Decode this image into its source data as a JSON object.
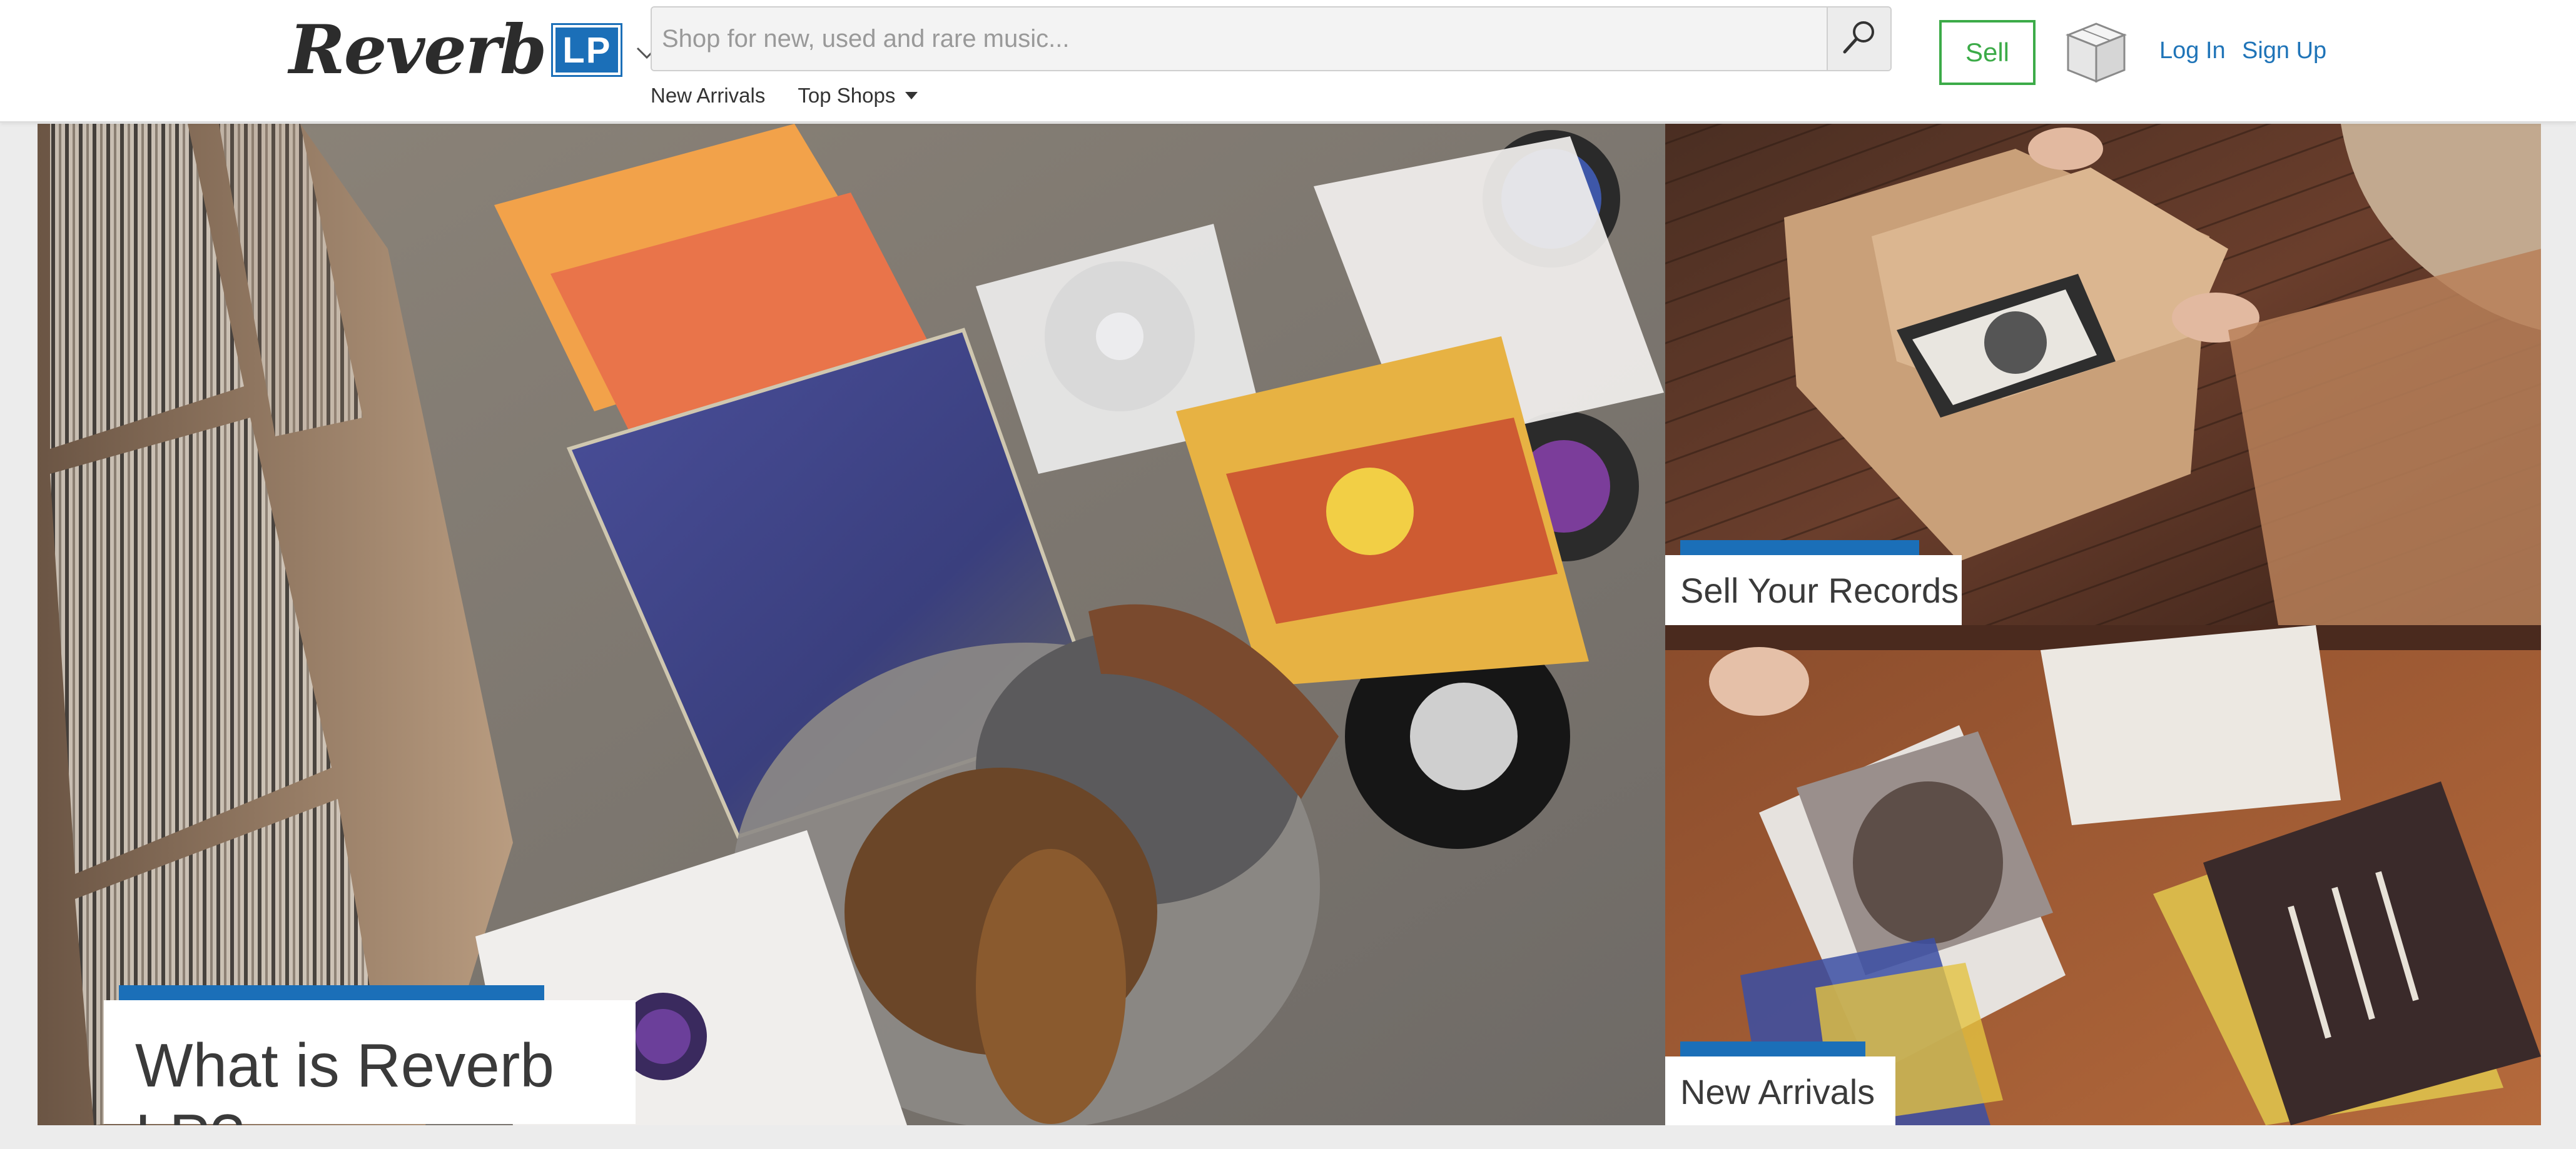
{
  "header": {
    "logo": {
      "wordmark": "Reverb",
      "badge": "LP",
      "dropdown_icon": "chevron-down-icon"
    },
    "search": {
      "placeholder": "Shop for new, used and rare music...",
      "button_icon": "search-icon"
    },
    "subnav": [
      {
        "label": "New Arrivals",
        "has_dropdown": false
      },
      {
        "label": "Top Shops",
        "has_dropdown": true
      }
    ],
    "sell_label": "Sell",
    "cart_icon": "box-icon",
    "login_label": "Log In",
    "signup_label": "Sign Up"
  },
  "hero": {
    "main": {
      "caption": "What is Reverb LP?"
    },
    "sell": {
      "caption": "Sell Your Records"
    },
    "new_arrivals": {
      "caption": "New Arrivals"
    }
  },
  "colors": {
    "brand_blue": "#1b6fb8",
    "sell_green": "#3cab48",
    "link_blue": "#1f74b8",
    "header_bg": "#ffffff",
    "page_bg": "#ececec"
  }
}
